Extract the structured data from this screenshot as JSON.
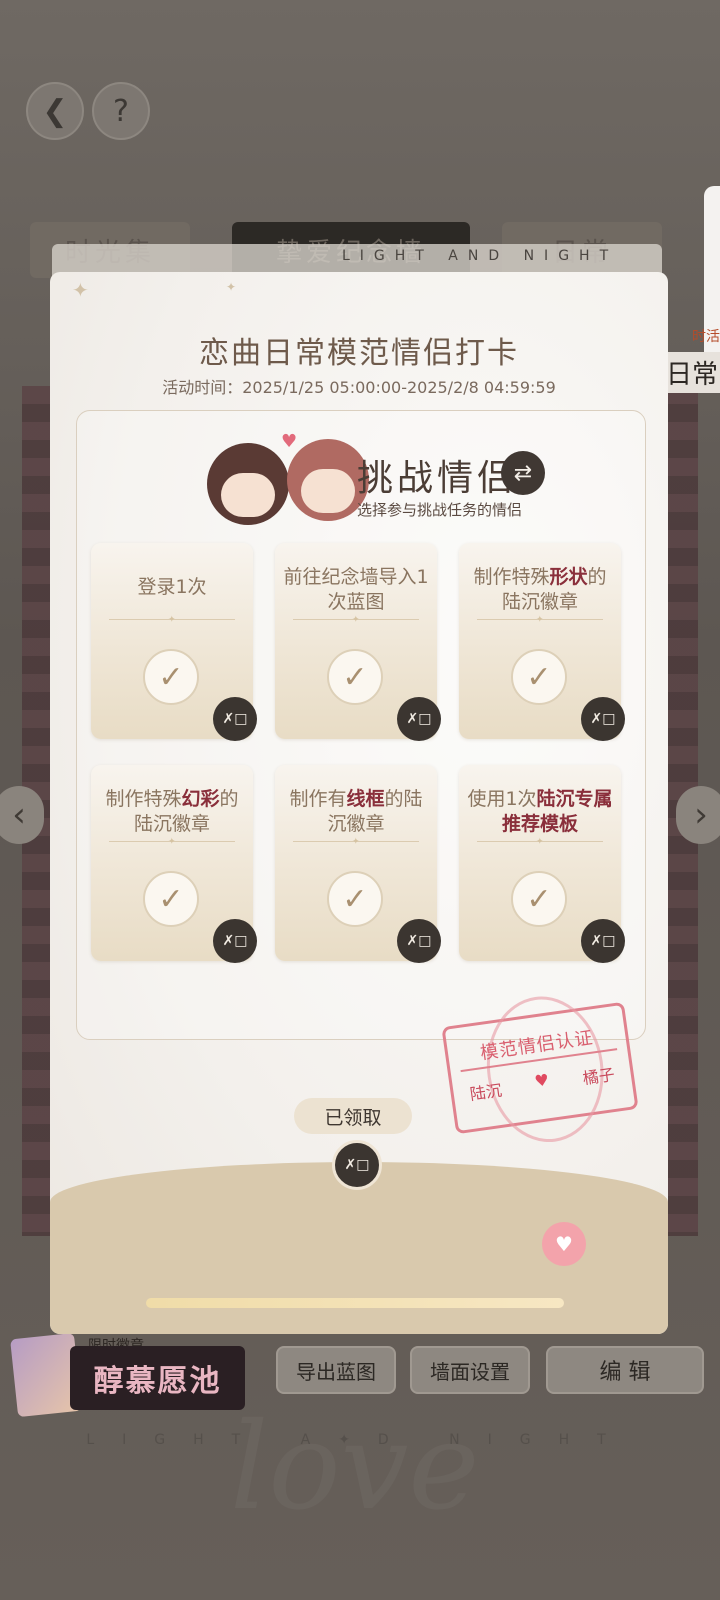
{
  "background": {
    "top_buttons": {
      "back_icon": "back-arrow-icon",
      "help_label": "?"
    },
    "tabs": [
      "时光集",
      "挚爱纪念墙",
      "日常"
    ],
    "right_fragment": "日常",
    "right_fragment_small": "时活",
    "limited_badge_small": "限时徽章",
    "limited_badge_title": "醇慕愿池",
    "bottom_buttons": {
      "export": "导出蓝图",
      "wall_settings": "墙面设置",
      "edit": "编 辑"
    },
    "footer_text": "LIGHT A✦D NIGHT",
    "script_text": "love"
  },
  "modal": {
    "header_strip": "LIGHT AND NIGHT",
    "title": "恋曲日常模范情侣打卡",
    "time": "活动时间：2025/1/25 05:00:00-2025/2/8 04:59:59",
    "partner": {
      "title": "挑战情侣",
      "subtitle": "选择参与挑战任务的情侣",
      "swap_icon": "swap-arrows-icon"
    },
    "tasks": [
      {
        "pre": "登录1次",
        "hl": "",
        "post": ""
      },
      {
        "pre": "前往纪念墙导入1次蓝图",
        "hl": "",
        "post": ""
      },
      {
        "pre": "制作特殊",
        "hl": "形状",
        "post": "的陆沉徽章"
      },
      {
        "pre": "制作特殊",
        "hl": "幻彩",
        "post": "的陆沉徽章"
      },
      {
        "pre": "制作有",
        "hl": "线框",
        "post": "的陆沉徽章"
      },
      {
        "pre": "使用1次",
        "hl": "陆沉专属推荐模板",
        "post": ""
      }
    ],
    "reward_icon_text": "✗□",
    "stamp": {
      "title": "模范情侣认证",
      "name_left": "陆沉",
      "name_right": "橘子"
    },
    "claim_label": "已领取",
    "progress": 1.0
  }
}
